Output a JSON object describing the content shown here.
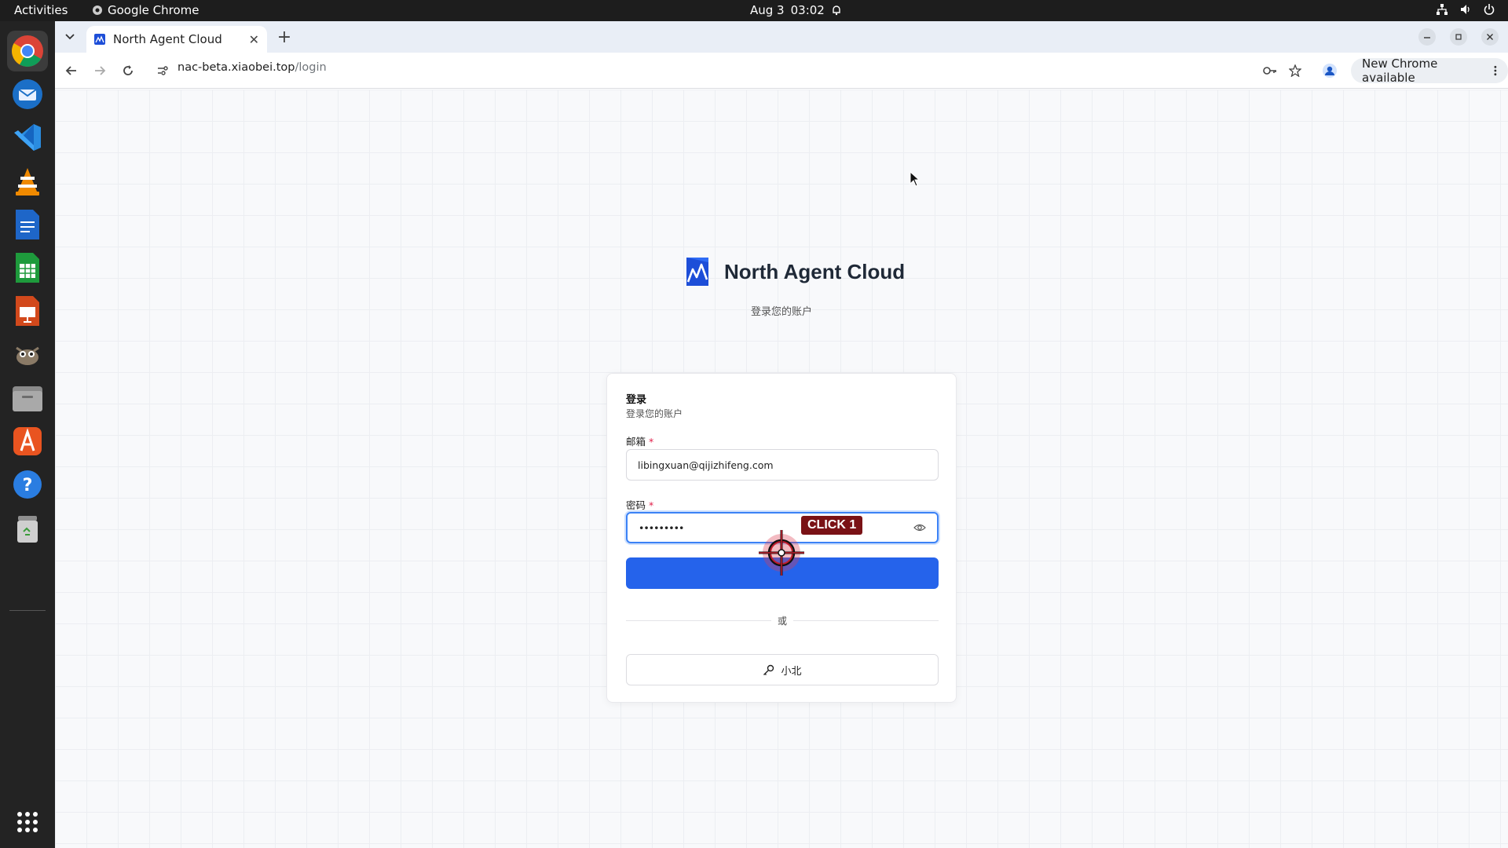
{
  "system": {
    "activities": "Activities",
    "app_name": "Google Chrome",
    "date": "Aug 3",
    "time": "03:02"
  },
  "dock": {
    "items": [
      "chrome-icon",
      "thunderbird-icon",
      "vscode-icon",
      "vlc-icon",
      "writer-icon",
      "calc-icon",
      "impress-icon",
      "gimp-icon",
      "files-icon",
      "app-center-icon",
      "help-icon",
      "trash-icon",
      "show-apps-icon"
    ]
  },
  "browser": {
    "tab_title": "North Agent Cloud",
    "url_host": "nac-beta.xiaobei.top",
    "url_path": "/login",
    "update_label": "New Chrome available"
  },
  "page": {
    "brand": "North Agent Cloud",
    "subtitle": "登录您的账户",
    "card": {
      "title": "登录",
      "subtitle": "登录您的账户",
      "email_label": "邮箱",
      "email_value": "libingxuan@qijizhifeng.com",
      "password_label": "密码",
      "password_value": "•••••••••",
      "required_mark": "*",
      "divider_text": "或",
      "sso_label": "小北"
    }
  },
  "overlay": {
    "click_label": "CLICK 1"
  },
  "colors": {
    "primary": "#2563eb",
    "focus": "#3b82f6",
    "brand": "#1d4ed8",
    "required": "#e11d48"
  }
}
